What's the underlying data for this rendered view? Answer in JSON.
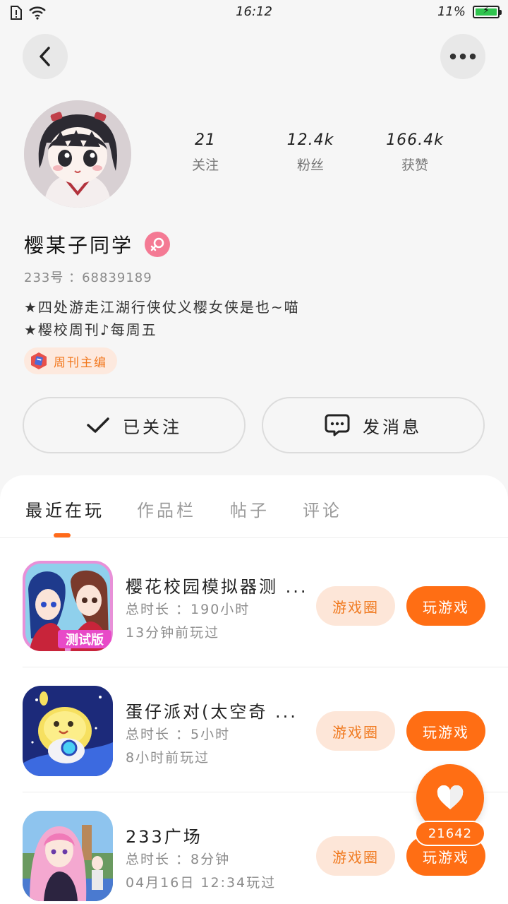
{
  "status_bar": {
    "time": "16:12",
    "battery": "11%"
  },
  "profile": {
    "name": "樱某子同学",
    "uid_label": "233号 ：68839189",
    "bio": [
      "★四处游走江湖行侠仗义樱女侠是也~喵",
      "★樱校周刊♪每周五"
    ],
    "tag": "周刊主编",
    "stats": [
      {
        "value": "21",
        "label": "关注"
      },
      {
        "value": "12.4k",
        "label": "粉丝"
      },
      {
        "value": "166.4k",
        "label": "获赞"
      }
    ]
  },
  "actions": {
    "follow": "已关注",
    "message": "发消息"
  },
  "tabs": [
    "最近在玩",
    "作品栏",
    "帖子",
    "评论"
  ],
  "active_tab": "最近在玩",
  "games": [
    {
      "title": "樱花校园模拟器测 ...",
      "duration": "总时长 ：190小时",
      "last_played": "13分钟前玩过",
      "icon_badge": "测试版",
      "circle_label": "游戏圈",
      "play_label": "玩游戏"
    },
    {
      "title": "蛋仔派对(太空奇 ...",
      "duration": "总时长 ：5小时",
      "last_played": "8小时前玩过",
      "circle_label": "游戏圈",
      "play_label": "玩游戏"
    },
    {
      "title": "233广场",
      "duration": "总时长 ：8分钟",
      "last_played": "04月16日 12:34玩过",
      "circle_label": "游戏圈",
      "play_label": "玩游戏"
    }
  ],
  "like_count": "21642",
  "colors": {
    "accent": "#ff6e14",
    "accent_light": "#fde6d8",
    "gender": "#f47a94",
    "background": "#f6f6f6"
  },
  "icons": [
    "back-icon",
    "more-icon",
    "check-icon",
    "chat-icon",
    "female-icon",
    "heart-icon",
    "wifi-icon",
    "sim-alert-icon"
  ]
}
